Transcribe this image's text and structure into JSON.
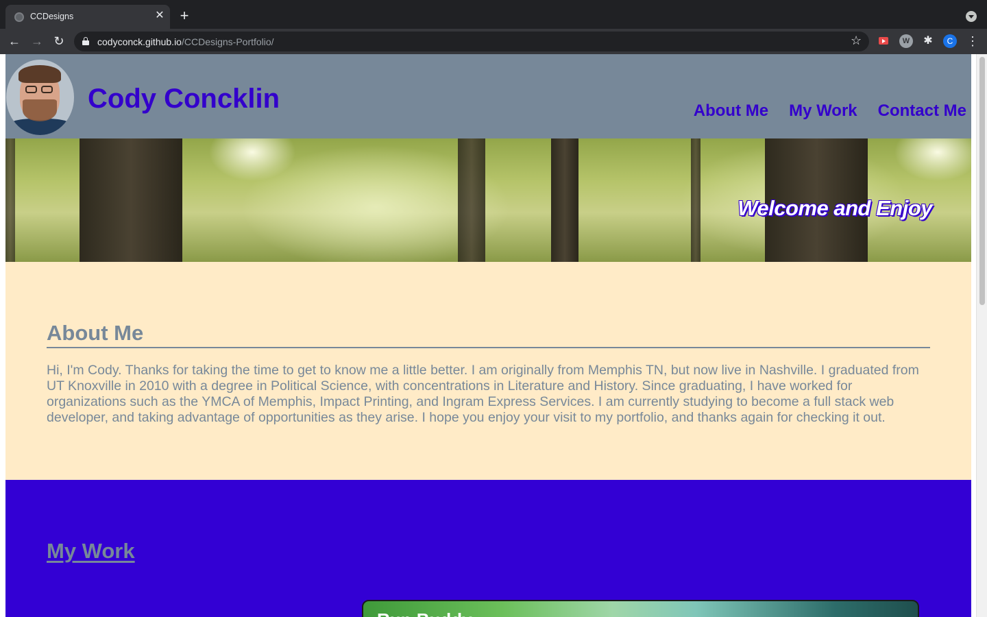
{
  "browser": {
    "tab_title": "CCDesigns",
    "url_host": "codyconck.github.io",
    "url_path": "/CCDesigns-Portfolio/",
    "profile_initial": "C",
    "ext_w_label": "W"
  },
  "header": {
    "name": "Cody Concklin",
    "nav": [
      "About Me",
      "My Work",
      "Contact Me"
    ]
  },
  "hero": {
    "tagline": "Welcome and Enjoy"
  },
  "about": {
    "heading": "About Me",
    "body": "Hi, I'm Cody. Thanks for taking the time to get to know me a little better. I am originally from Memphis TN, but now live in Nashville. I graduated from UT Knoxville in 2010 with a degree in Political Science, with concentrations in Literature and History. Since graduating, I have worked for organizations such as the YMCA of Memphis, Impact Printing, and Ingram Express Services. I am currently studying to become a full stack web developer, and taking advantage of opportunities as they arise. I hope you enjoy your visit to my portfolio, and thanks again for checking it out."
  },
  "work": {
    "heading": "My Work",
    "first_project_title": "Run Buddy"
  },
  "colors": {
    "header_bg": "#778899",
    "accent": "#3300cc",
    "about_bg": "#ffebc7",
    "work_bg": "#3300d4"
  }
}
